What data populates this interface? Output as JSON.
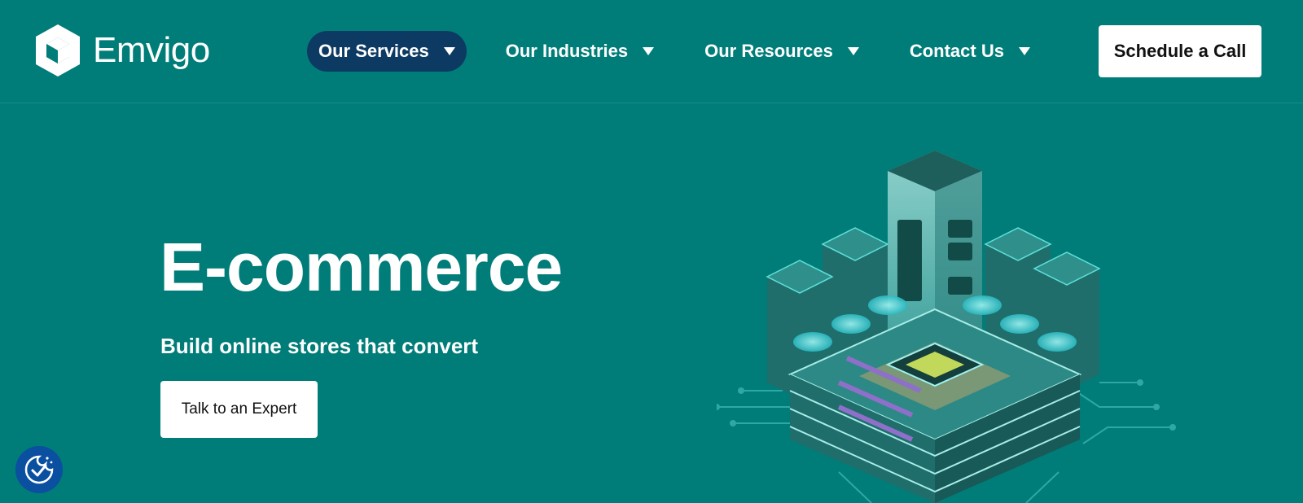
{
  "brand": {
    "name": "Emvigo",
    "icon": "cube-logo-icon"
  },
  "nav": {
    "items": [
      {
        "label": "Our Services",
        "active": true
      },
      {
        "label": "Our Industries",
        "active": false
      },
      {
        "label": "Our Resources",
        "active": false
      },
      {
        "label": "Contact Us",
        "active": false
      }
    ]
  },
  "header": {
    "cta_label": "Schedule a Call"
  },
  "hero": {
    "title": "E-commerce",
    "subtitle": "Build online stores that convert",
    "button_label": "Talk to an Expert",
    "illustration": "isometric-server-datacenter-illustration"
  },
  "cookie_badge": {
    "icon": "cookie-consent-icon"
  },
  "colors": {
    "background": "#007d78",
    "nav_active": "#0d3a63",
    "cookie_badge": "#0b4fa0",
    "button_bg": "#ffffff"
  }
}
